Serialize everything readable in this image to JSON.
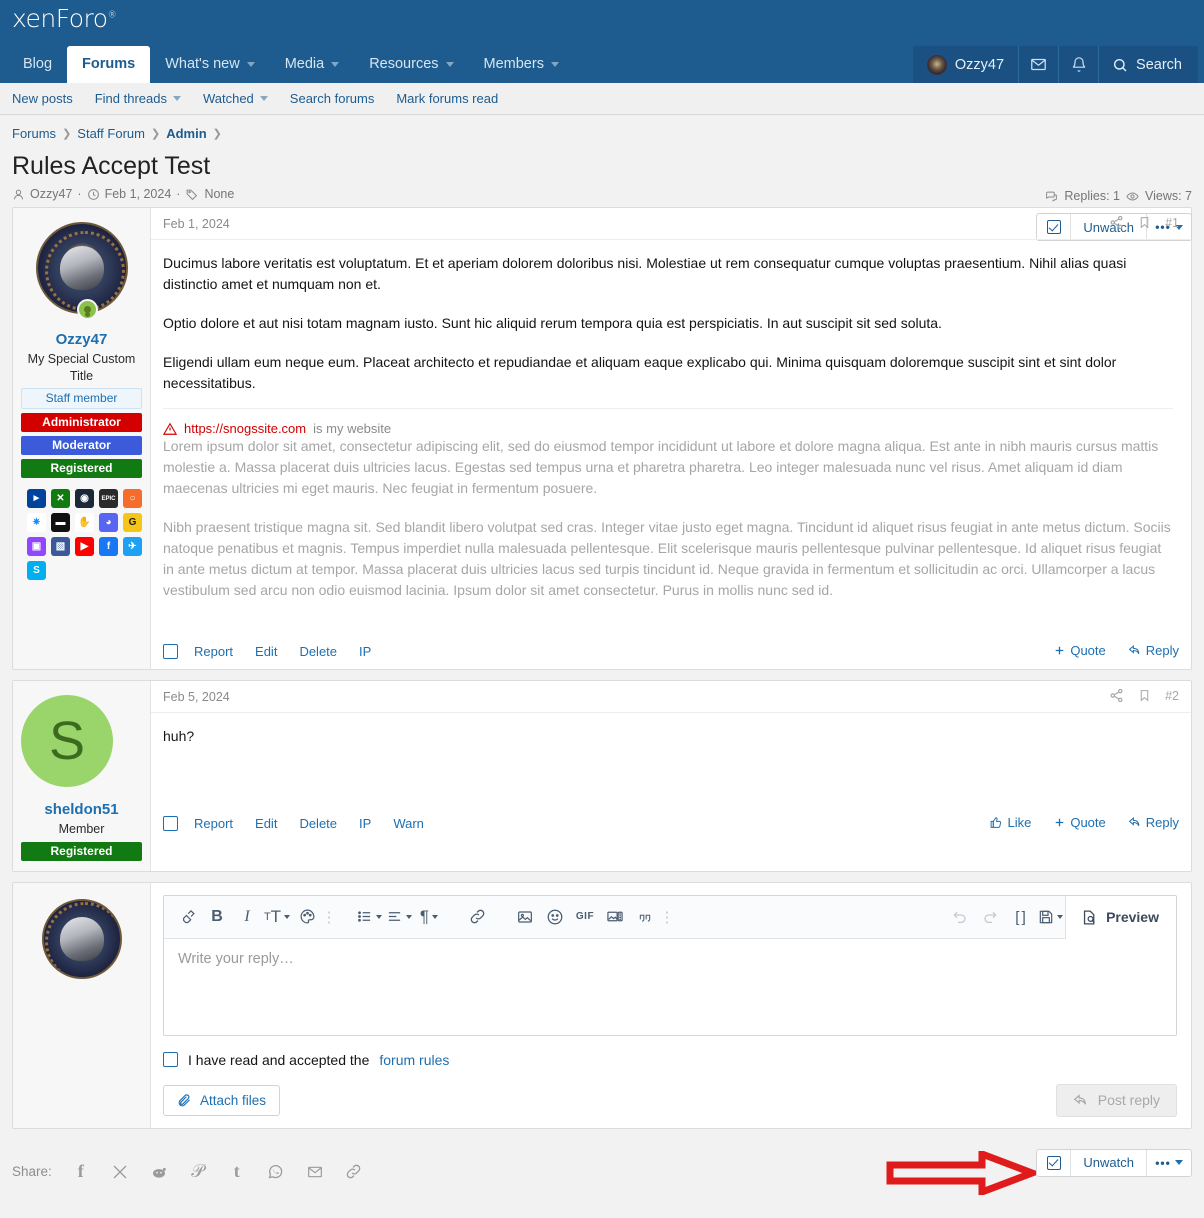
{
  "site": {
    "logo": "xenForo",
    "logo_mark": "®"
  },
  "nav": {
    "items": [
      {
        "label": "Blog",
        "has_caret": false,
        "active": false
      },
      {
        "label": "Forums",
        "has_caret": false,
        "active": true
      },
      {
        "label": "What's new",
        "has_caret": true,
        "active": false
      },
      {
        "label": "Media",
        "has_caret": true,
        "active": false
      },
      {
        "label": "Resources",
        "has_caret": true,
        "active": false
      },
      {
        "label": "Members",
        "has_caret": true,
        "active": false
      }
    ],
    "user": "Ozzy47",
    "inbox_icon": "envelope-icon",
    "alerts_icon": "bell-icon",
    "search_label": "Search"
  },
  "subnav": {
    "items": [
      {
        "label": "New posts",
        "has_caret": false
      },
      {
        "label": "Find threads",
        "has_caret": true
      },
      {
        "label": "Watched",
        "has_caret": true
      },
      {
        "label": "Search forums",
        "has_caret": false
      },
      {
        "label": "Mark forums read",
        "has_caret": false
      }
    ]
  },
  "breadcrumb": [
    {
      "label": "Forums",
      "current": false
    },
    {
      "label": "Staff Forum",
      "current": false
    },
    {
      "label": "Admin",
      "current": true
    }
  ],
  "thread": {
    "title": "Rules Accept Test",
    "author": "Ozzy47",
    "date": "Feb 1, 2024",
    "tags": "None",
    "replies_label": "Replies: 1",
    "views_label": "Views: 7",
    "watch_label": "Unwatch"
  },
  "posts": [
    {
      "date": "Feb 1, 2024",
      "number": "#1",
      "author": {
        "name": "Ozzy47",
        "title": "My Special Custom Title",
        "avatar_type": "image",
        "online": true,
        "badges": [
          {
            "label": "Staff member",
            "style": "staff"
          },
          {
            "label": "Administrator",
            "style": "admin"
          },
          {
            "label": "Moderator",
            "style": "mod"
          },
          {
            "label": "Registered",
            "style": "reg"
          }
        ],
        "social": [
          {
            "name": "playstation-icon",
            "glyph": "⬤",
            "bg": "#00439c",
            "fg": "#ffffff",
            "text": "PS"
          },
          {
            "name": "xbox-icon",
            "glyph": "X",
            "bg": "#107c10",
            "fg": "#ffffff",
            "text": "X"
          },
          {
            "name": "steam-icon",
            "glyph": "S",
            "bg": "#1b2838",
            "fg": "#ffffff",
            "text": "⚭"
          },
          {
            "name": "epic-games-icon",
            "glyph": "E",
            "bg": "#2a2a2a",
            "fg": "#ffffff",
            "text": "EPIC"
          },
          {
            "name": "origin-icon",
            "glyph": "O",
            "bg": "#f56c2d",
            "fg": "#ffffff",
            "text": "O"
          },
          {
            "name": "battlenet-icon",
            "glyph": "B",
            "bg": "#ffffff",
            "fg": "#148eff",
            "text": "✳"
          },
          {
            "name": "gog-icon",
            "glyph": "G",
            "bg": "#0f0f0f",
            "fg": "#ffffff",
            "text": "▬"
          },
          {
            "name": "ubisoft-icon",
            "glyph": "U",
            "bg": "#ffffff",
            "fg": "#111111",
            "text": "✋"
          },
          {
            "name": "discord-icon",
            "glyph": "D",
            "bg": "#5865f2",
            "fg": "#ffffff",
            "text": "◑"
          },
          {
            "name": "g2a-icon",
            "glyph": "G",
            "bg": "#f5c518",
            "fg": "#1a1a1a",
            "text": "G"
          },
          {
            "name": "twitch-icon",
            "glyph": "T",
            "bg": "#9146ff",
            "fg": "#ffffff",
            "text": "▣"
          },
          {
            "name": "flickr-icon",
            "glyph": "F",
            "bg": "#3b5998",
            "fg": "#ffffff",
            "text": "◧"
          },
          {
            "name": "youtube-icon",
            "glyph": "Y",
            "bg": "#ff0000",
            "fg": "#ffffff",
            "text": "▶"
          },
          {
            "name": "facebook-icon",
            "glyph": "f",
            "bg": "#1877f2",
            "fg": "#ffffff",
            "text": "f"
          },
          {
            "name": "twitter-icon",
            "glyph": "t",
            "bg": "#1da1f2",
            "fg": "#ffffff",
            "text": "✒"
          },
          {
            "name": "skype-icon",
            "glyph": "S",
            "bg": "#00aff0",
            "fg": "#ffffff",
            "text": "S"
          }
        ]
      },
      "paragraphs": [
        "Ducimus labore veritatis est voluptatum. Et et aperiam dolorem doloribus nisi. Molestiae ut rem consequatur cumque voluptas praesentium. Nihil alias quasi distinctio amet et numquam non et.",
        "Optio dolore et aut nisi totam magnam iusto. Sunt hic aliquid rerum tempora quia est perspiciatis. In aut suscipit sit sed soluta.",
        "Eligendi ullam eum neque eum. Placeat architecto et repudiandae et aliquam eaque explicabo qui. Minima quisquam doloremque suscipit sint et sint dolor necessitatibus."
      ],
      "warning_link": "https://snogssite.com",
      "warning_suffix": "is my website",
      "dim_paragraphs": [
        "Lorem ipsum dolor sit amet, consectetur adipiscing elit, sed do eiusmod tempor incididunt ut labore et dolore magna aliqua. Est ante in nibh mauris cursus mattis molestie a. Massa placerat duis ultricies lacus. Egestas sed tempus urna et pharetra pharetra. Leo integer malesuada nunc vel risus. Amet aliquam id diam maecenas ultricies mi eget mauris. Nec feugiat in fermentum posuere.",
        "Nibh praesent tristique magna sit. Sed blandit libero volutpat sed cras. Integer vitae justo eget magna. Tincidunt id aliquet risus feugiat in ante metus dictum. Sociis natoque penatibus et magnis. Tempus imperdiet nulla malesuada pellentesque. Elit scelerisque mauris pellentesque pulvinar pellentesque. Id aliquet risus feugiat in ante metus dictum at tempor. Massa placerat duis ultricies lacus sed turpis tincidunt id. Neque gravida in fermentum et sollicitudin ac orci. Ullamcorper a lacus vestibulum sed arcu non odio euismod lacinia. Ipsum dolor sit amet consectetur. Purus in mollis nunc sed id."
      ],
      "actions": [
        "Report",
        "Edit",
        "Delete",
        "IP"
      ],
      "right_actions": [
        {
          "label": "Quote",
          "icon": "plus-icon"
        },
        {
          "label": "Reply",
          "icon": "reply-arrow-icon"
        }
      ]
    },
    {
      "date": "Feb 5, 2024",
      "number": "#2",
      "author": {
        "name": "sheldon51",
        "title": "Member",
        "avatar_type": "letter",
        "avatar_letter": "S",
        "online": false,
        "badges": [
          {
            "label": "Registered",
            "style": "reg"
          }
        ],
        "social": []
      },
      "paragraphs": [
        "huh?"
      ],
      "dim_paragraphs": [],
      "actions": [
        "Report",
        "Edit",
        "Delete",
        "IP",
        "Warn"
      ],
      "right_actions": [
        {
          "label": "Like",
          "icon": "thumbs-up-icon"
        },
        {
          "label": "Quote",
          "icon": "plus-icon"
        },
        {
          "label": "Reply",
          "icon": "reply-arrow-icon"
        }
      ]
    }
  ],
  "editor": {
    "toolbar_left": [
      {
        "name": "remove-formatting-icon",
        "glyph": "◇",
        "caret": false
      },
      {
        "name": "bold-icon",
        "glyph": "B",
        "caret": false
      },
      {
        "name": "italic-icon",
        "glyph": "I",
        "caret": false
      },
      {
        "name": "font-size-icon",
        "glyph": "ᴛT",
        "caret": true
      },
      {
        "name": "text-color-icon",
        "glyph": "◕",
        "caret": false
      },
      {
        "name": "more-inline-icon",
        "glyph": "⋮",
        "caret": false
      }
    ],
    "toolbar_list": [
      {
        "name": "bullet-list-icon",
        "glyph": "☰",
        "caret": true
      },
      {
        "name": "align-icon",
        "glyph": "≡",
        "caret": true
      },
      {
        "name": "paragraph-icon",
        "glyph": "¶",
        "caret": true
      }
    ],
    "toolbar_insert": [
      {
        "name": "link-icon",
        "glyph": "🔗",
        "caret": false
      },
      {
        "name": "image-icon",
        "glyph": "⛰",
        "caret": false
      },
      {
        "name": "smilie-icon",
        "glyph": "☺",
        "caret": false
      },
      {
        "name": "gif-icon",
        "glyph": "GIF",
        "caret": false
      },
      {
        "name": "media-icon",
        "glyph": "▦",
        "caret": false
      },
      {
        "name": "quote-icon",
        "glyph": "”",
        "caret": false
      },
      {
        "name": "more-insert-icon",
        "glyph": "⋮",
        "caret": false
      }
    ],
    "toolbar_right": [
      {
        "name": "undo-icon",
        "glyph": "↶",
        "caret": false,
        "disabled": true
      },
      {
        "name": "redo-icon",
        "glyph": "↷",
        "caret": false,
        "disabled": true
      },
      {
        "name": "bb-code-icon",
        "glyph": "[ ]",
        "caret": false,
        "disabled": false
      },
      {
        "name": "drafts-icon",
        "glyph": "💾",
        "caret": true,
        "disabled": false
      }
    ],
    "preview_label": "Preview",
    "placeholder": "Write your reply…",
    "rules_text": "I have read and accepted the",
    "rules_link": "forum rules",
    "attach_label": "Attach files",
    "post_reply_label": "Post reply"
  },
  "footer": {
    "share_label": "Share:",
    "share_icons": [
      {
        "name": "facebook-share-icon",
        "glyph": "f"
      },
      {
        "name": "x-twitter-share-icon",
        "glyph": "𝕏"
      },
      {
        "name": "reddit-share-icon",
        "glyph": "Ⓡ"
      },
      {
        "name": "pinterest-share-icon",
        "glyph": "℗"
      },
      {
        "name": "tumblr-share-icon",
        "glyph": "t"
      },
      {
        "name": "whatsapp-share-icon",
        "glyph": "☎"
      },
      {
        "name": "email-share-icon",
        "glyph": "✉"
      },
      {
        "name": "link-share-icon",
        "glyph": "🔗"
      }
    ],
    "watch_label": "Unwatch"
  },
  "annotation": {
    "arrow_color": "#e01b1b"
  },
  "colors": {
    "header_blue": "#1e5c8f",
    "link_blue": "#1e6fb0",
    "admin_red": "#d40000",
    "mod_blue": "#3b5bdb",
    "registered_green": "#127a12"
  }
}
